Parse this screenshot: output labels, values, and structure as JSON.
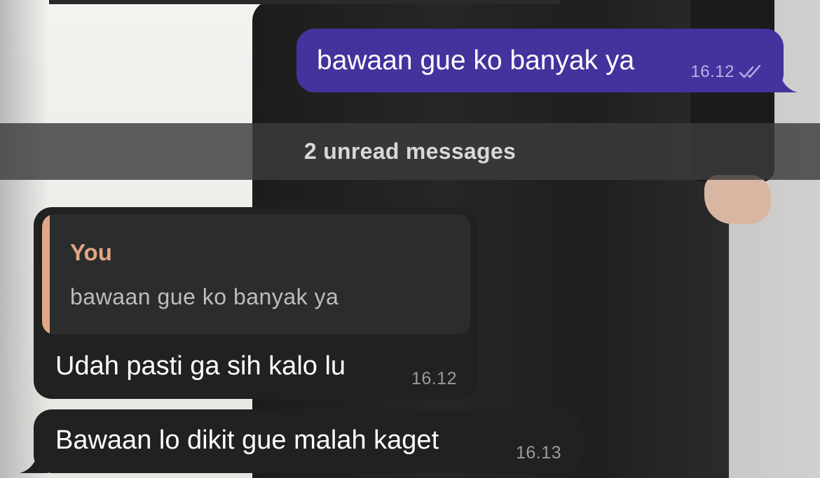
{
  "messages": {
    "outgoing": {
      "text": "bawaan gue ko banyak ya",
      "time": "16.12",
      "status_icon": "double-check-icon",
      "bubble_color": "#45329c"
    },
    "unread_separator": "2 unread messages",
    "incoming": [
      {
        "reply_author": "You",
        "reply_text": "bawaan gue ko banyak ya",
        "text": "Udah pasti ga sih kalo lu",
        "time": "16.12"
      },
      {
        "text": "Bawaan lo dikit gue malah kaget",
        "time": "16.13"
      }
    ]
  },
  "colors": {
    "incoming_bubble": "#202121",
    "reply_accent": "#e0a888",
    "reply_author": "#e3a684"
  }
}
